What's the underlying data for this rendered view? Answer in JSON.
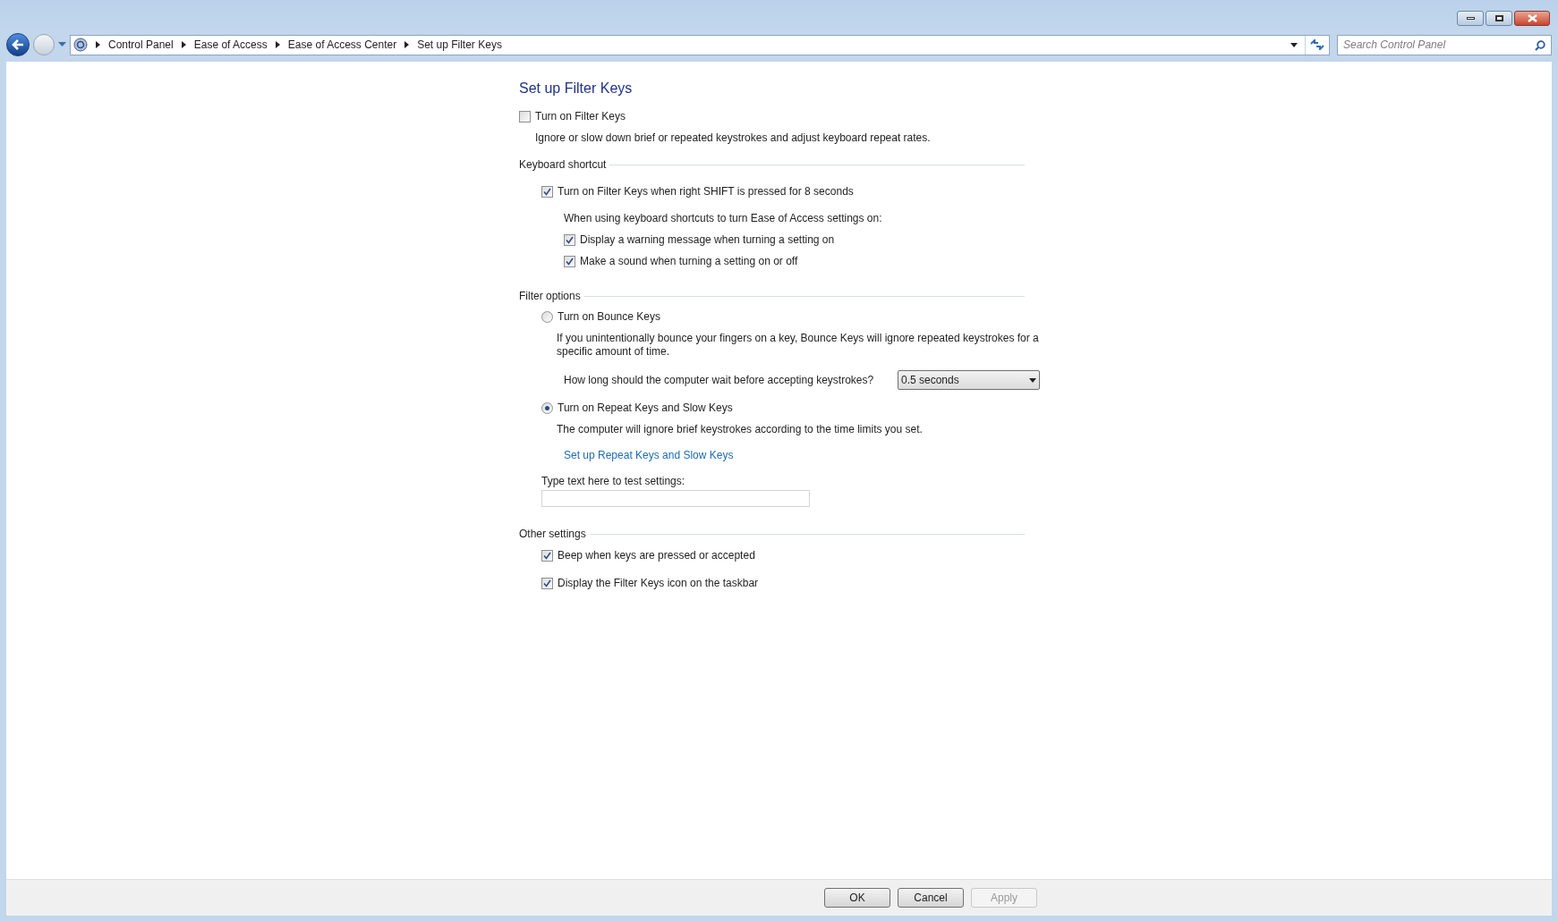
{
  "breadcrumb": [
    "Control Panel",
    "Ease of Access",
    "Ease of Access Center",
    "Set up Filter Keys"
  ],
  "search": {
    "placeholder": "Search Control Panel"
  },
  "title": "Set up Filter Keys",
  "main_toggle": {
    "label": "Turn on Filter Keys",
    "checked": false,
    "description": "Ignore or slow down brief or repeated keystrokes and adjust keyboard repeat rates."
  },
  "keyboard_shortcut": {
    "heading": "Keyboard shortcut",
    "shortcut": {
      "label": "Turn on Filter Keys when right SHIFT is pressed for 8 seconds",
      "checked": true
    },
    "note": "When using keyboard shortcuts to turn Ease of Access settings on:",
    "options": [
      {
        "label": "Display a warning message when turning a setting on",
        "checked": true
      },
      {
        "label": "Make a sound when turning a setting on or off",
        "checked": true
      }
    ]
  },
  "filter_options": {
    "heading": "Filter options",
    "bounce": {
      "label": "Turn on Bounce Keys",
      "selected": false,
      "description": "If you unintentionally bounce your fingers on a key, Bounce Keys will ignore repeated keystrokes for a specific amount of time.",
      "question": "How long should the computer wait before accepting keystrokes?",
      "value": "0.5 seconds"
    },
    "repeat": {
      "label": "Turn on Repeat Keys and Slow Keys",
      "selected": true,
      "description": "The computer will ignore brief keystrokes according to the time limits you set.",
      "link": "Set up Repeat Keys and Slow Keys"
    },
    "test_label": "Type text here to test settings:"
  },
  "other_settings": {
    "heading": "Other settings",
    "options": [
      {
        "label": "Beep when keys are pressed or accepted",
        "checked": true
      },
      {
        "label": "Display the Filter Keys icon on the taskbar",
        "checked": true
      }
    ]
  },
  "buttons": [
    {
      "label": "OK",
      "disabled": false
    },
    {
      "label": "Cancel",
      "disabled": false
    },
    {
      "label": "Apply",
      "disabled": true
    }
  ]
}
